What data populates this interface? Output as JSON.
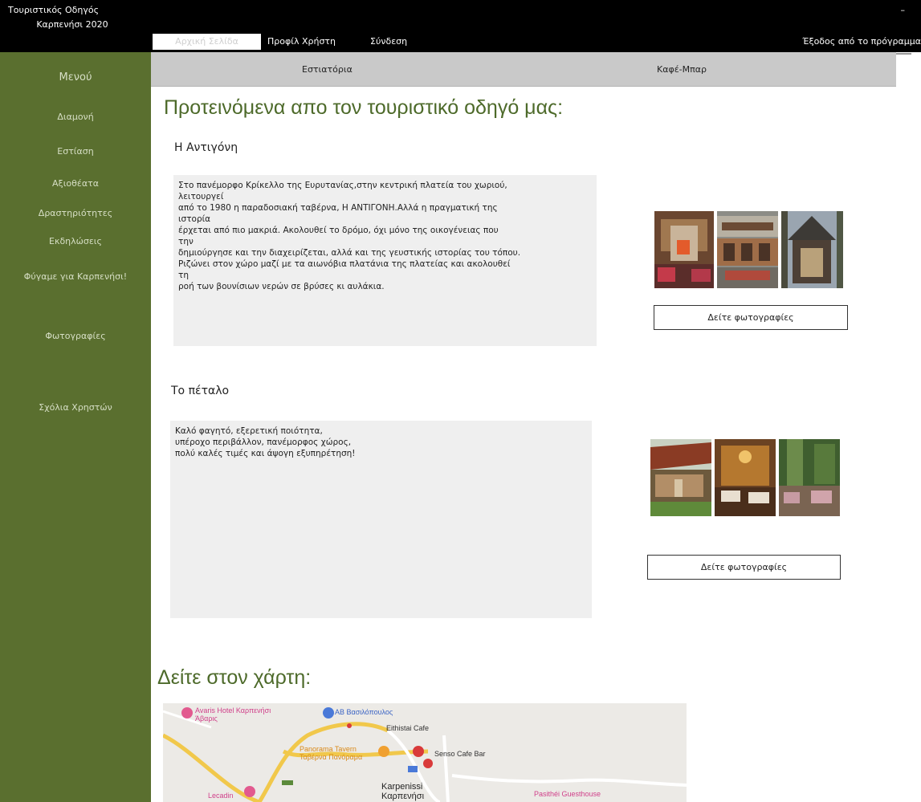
{
  "app": {
    "title_line1": "Τουριστικός Οδηγός",
    "title_line2": "Καρπενήσι 2020",
    "minimize": "–"
  },
  "topnav": {
    "home": "Αρχική Σελίδα",
    "profile": "Προφίλ Χρήστη",
    "login": "Σύνδεση",
    "exit": "Έξοδος από το πρόγραμμα"
  },
  "sidebar": {
    "menu": "Μενού",
    "items": [
      "Διαμονή",
      "Εστίαση",
      "Αξιοθέατα",
      "Δραστηριότητες",
      "Εκδηλώσεις",
      "Φύγαμε για Καρπενήσι!",
      "Φωτογραφίες",
      "Σχόλια Χρηστών"
    ]
  },
  "subnav": {
    "restaurants": "Εστιατόρια",
    "cafe": "Καφέ-Μπαρ"
  },
  "main": {
    "recommended_title": "Προτεινόμενα απο τον τουριστικό οδηγό μας:",
    "places": [
      {
        "name": "Η Αντιγόνη",
        "description_lines": [
          "Στο πανέμορφο Κρίκελλο της Ευρυτανίας,στην κεντρική πλατεία του χωριού,",
          "λειτουργεί",
          "από το 1980 η παραδοσιακή ταβέρνα, Η ΑΝΤΙΓΟΝΗ.Αλλά η πραγματική της",
          "ιστορία",
          "έρχεται από πιο μακριά. Ακολουθεί το δρόμο, όχι μόνο της οικογένειας που",
          "την",
          "δημιούργησε και την διαχειρίζεται, αλλά και της γευστικής ιστορίας του τόπου.",
          "Ριζώνει στον χώρο μαζί με τα αιωνόβια πλατάνια της πλατείας και ακολουθεί",
          "τη",
          "ροή των βουνίσιων νερών σε βρύσες κι αυλάκια."
        ],
        "photos_button": "Δείτε φωτογραφίες"
      },
      {
        "name": "Το πέταλο",
        "description_lines": [
          "Καλό φαγητό, εξερετική ποιότητα,",
          "υπέροχο περιβάλλον, πανέμορφος χώρος,",
          "πολύ καλές τιμές και άψογη εξυπηρέτηση!"
        ],
        "photos_button": "Δείτε φωτογραφίες"
      }
    ],
    "map_title": "Δείτε στον χάρτη:"
  },
  "map": {
    "labels": {
      "hotel": "Avaris Hotel Καρπενήσι",
      "hotel_sub": "Άβαρις",
      "store": "ΑΒ Βασιλόπουλος",
      "cafe1": "Eithistai Cafe",
      "taverna": "Panorama Tavern",
      "taverna_sub": "Ταβέρνα Πανόραμα",
      "cafe2": "Senso Cafe Bar",
      "town": "Karpenissi",
      "town_sub": "Καρπενήσι",
      "guesthouse": "Pasithéi Guesthouse",
      "left": "Lecadin"
    },
    "colors": {
      "roads": "#f1c84b",
      "pins": "#d93a3a",
      "water": "#a9c6e8"
    }
  },
  "colors": {
    "topbar": "#000000",
    "sidebar": "#5a6f2f",
    "heading": "#4d6a2a",
    "subnav": "#c9c9c9",
    "box": "#efefef"
  }
}
